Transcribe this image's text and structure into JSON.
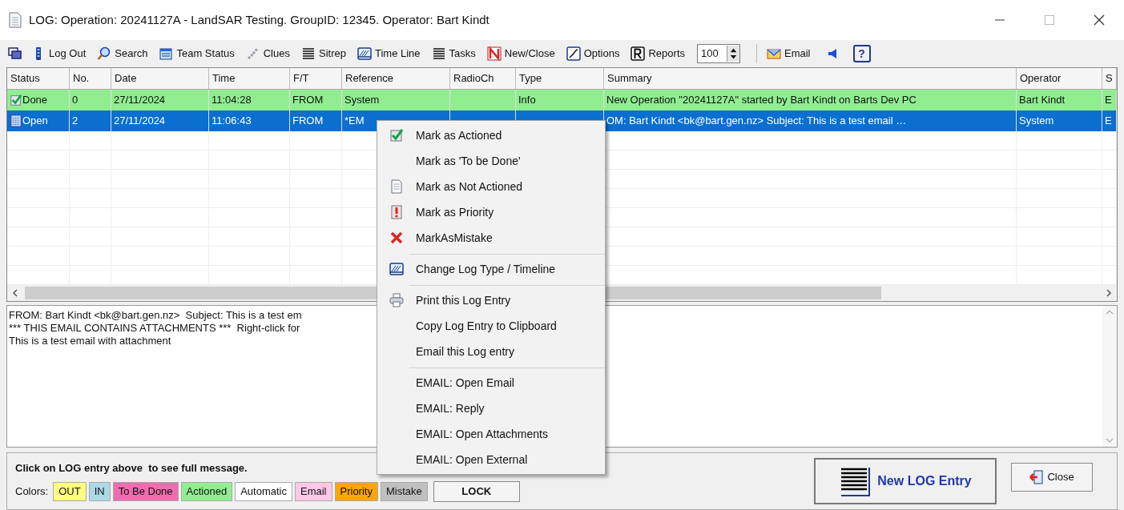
{
  "window": {
    "title": "LOG: Operation: 20241127A - LandSAR Testing.  GroupID: 12345.  Operator: Bart Kindt"
  },
  "toolbar": [
    {
      "kind": "windows"
    },
    {
      "kind": "logout",
      "label": "Log Out"
    },
    {
      "kind": "search",
      "label": "Search"
    },
    {
      "kind": "team",
      "label": "Team Status"
    },
    {
      "kind": "clues",
      "label": "Clues"
    },
    {
      "kind": "lines",
      "label": "Sitrep"
    },
    {
      "kind": "timeline",
      "label": "Time Line"
    },
    {
      "kind": "lines",
      "label": "Tasks"
    },
    {
      "kind": "newclose",
      "label": "New/Close"
    },
    {
      "kind": "options",
      "label": "Options"
    },
    {
      "kind": "reports",
      "label": "Reports"
    },
    {
      "kind": "spinner",
      "value": "100"
    },
    {
      "kind": "email",
      "label": "Email"
    },
    {
      "kind": "speaker"
    },
    {
      "kind": "help",
      "label": "?"
    }
  ],
  "table": {
    "columns": [
      "Status",
      "No.",
      "Date",
      "Time",
      "F/T",
      "Reference",
      "RadioCh",
      "Type",
      "Summary",
      "Operator",
      "S"
    ],
    "rows": [
      {
        "selected": false,
        "color": "#90ee90",
        "kind": "check",
        "cells": [
          "Done",
          "0",
          "27/11/2024",
          "11:04:28",
          "FROM",
          "System",
          "",
          "Info",
          "New Operation \"20241127A\" started by Bart Kindt on Barts Dev PC",
          "Bart Kindt",
          "E"
        ]
      },
      {
        "selected": true,
        "kind": "note",
        "cells": [
          "Open",
          "2",
          "27/11/2024",
          "11:06:43",
          "FROM",
          "*EM",
          "",
          "",
          "OM: Bart Kindt <bk@bart.gen.nz>  Subject: This is a test email …",
          "System",
          "E"
        ]
      }
    ]
  },
  "message": [
    "FROM: Bart Kindt <bk@bart.gen.nz>  Subject: This is a test em",
    "*** THIS EMAIL CONTAINS ATTACHMENTS ***  Right-click for",
    "This is a test email with attachment"
  ],
  "context_menu": [
    [
      {
        "kind": "check",
        "label": "Mark as Actioned"
      },
      {
        "label": "Mark as 'To be Done'"
      },
      {
        "kind": "page",
        "label": "Mark as Not Actioned"
      },
      {
        "kind": "priority",
        "label": "Mark as Priority"
      },
      {
        "kind": "cross",
        "label": "MarkAsMistake"
      }
    ],
    [
      {
        "kind": "timeline",
        "label": "Change Log Type / Timeline"
      }
    ],
    [
      {
        "kind": "printer",
        "label": "Print this Log Entry"
      },
      {
        "label": "Copy Log Entry to Clipboard"
      },
      {
        "label": "Email this Log entry"
      }
    ],
    [
      {
        "label": "EMAIL: Open Email"
      },
      {
        "label": "EMAIL: Reply"
      },
      {
        "label": "EMAIL: Open Attachments"
      },
      {
        "label": "EMAIL: Open External"
      }
    ]
  ],
  "footer": {
    "hint": "Click on LOG entry above  to see full message.",
    "colors_label": "Colors:",
    "colors": [
      {
        "label": "OUT",
        "color": "#ffff80"
      },
      {
        "label": "IN",
        "color": "#add8e6"
      },
      {
        "label": "To Be Done",
        "color": "#f06cb0"
      },
      {
        "label": "Actioned",
        "color": "#90ee90"
      },
      {
        "label": "Automatic",
        "color": "#ffffff"
      },
      {
        "label": "Email",
        "color": "#ffc8e6"
      },
      {
        "label": "Priority",
        "color": "#ffa500"
      },
      {
        "label": "Mistake",
        "color": "#c0c0c0"
      }
    ],
    "lock": "LOCK",
    "new_entry": "New LOG Entry",
    "close": "Close"
  }
}
